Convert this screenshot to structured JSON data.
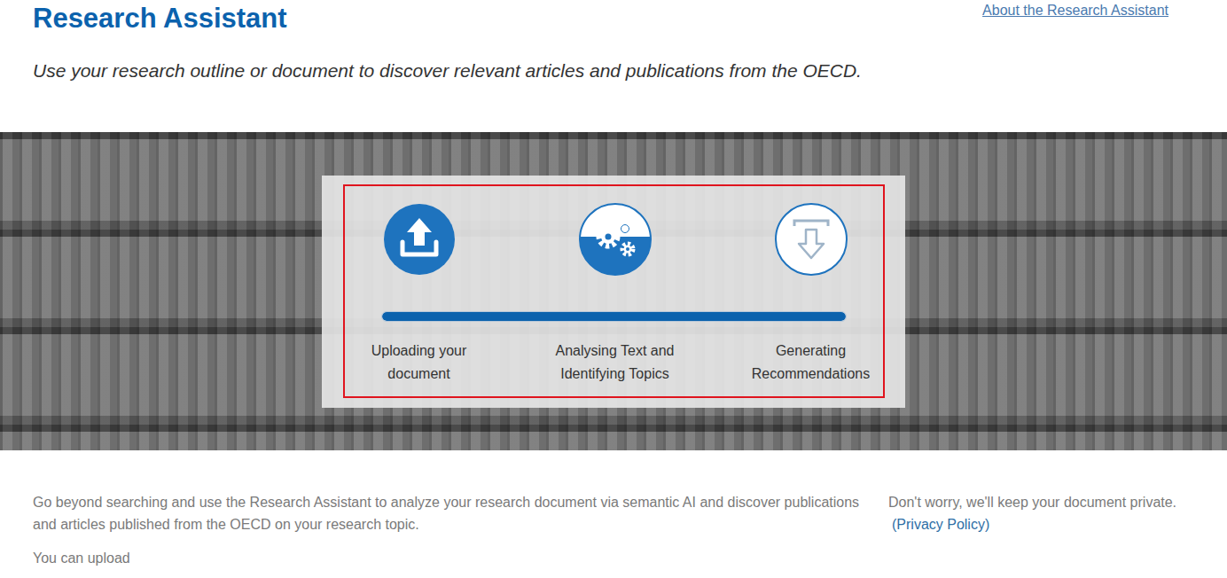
{
  "header": {
    "title": "Research Assistant",
    "about_link": "About the Research Assistant",
    "subtitle": "Use your research outline or document to discover relevant articles and publications from the OECD."
  },
  "progress": {
    "level": 1,
    "steps": [
      {
        "kind": "upload",
        "label": "Uploading your document",
        "status": "done"
      },
      {
        "kind": "analyse",
        "label": "Analysing Text and Identifying Topics",
        "status": "active"
      },
      {
        "kind": "download",
        "label": "Generating Recommendations",
        "status": "pending"
      }
    ]
  },
  "intro": {
    "text": "Go beyond searching and use the Research Assistant to analyze your research document via semantic AI and discover publications and articles published from the OECD on your research topic.",
    "upload_hint": "You can upload"
  },
  "privacy": {
    "text": "Don't worry, we'll keep your document private.",
    "link": "(Privacy Policy)"
  }
}
